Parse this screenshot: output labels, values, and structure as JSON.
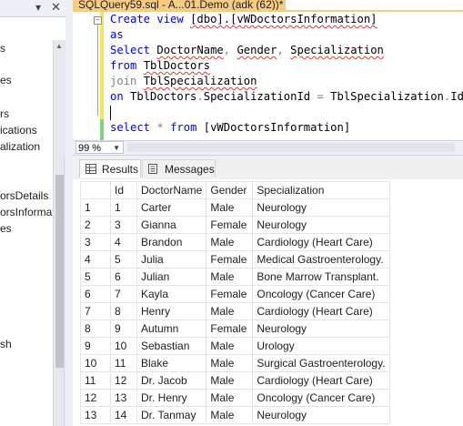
{
  "object_explorer": {
    "items": [
      "s",
      "es",
      "rs",
      "ications",
      "alization",
      "orsDetails",
      "orsInformat",
      "es",
      "sh"
    ]
  },
  "editor": {
    "tab_title": "SQLQuery59.sql - A...01.Demo (adk (62))*",
    "lines": [
      {
        "parts": [
          {
            "t": "Create view ",
            "c": "kw"
          },
          {
            "t": "[dbo].[vWDoctorsInformation]",
            "c": "sq"
          }
        ]
      },
      {
        "parts": [
          {
            "t": "as",
            "c": "kw"
          }
        ]
      },
      {
        "parts": [
          {
            "t": "Select ",
            "c": "kw"
          },
          {
            "t": "DoctorName",
            "c": "sq"
          },
          {
            "t": ", ",
            "c": "gr"
          },
          {
            "t": "Gender",
            "c": "sq"
          },
          {
            "t": ", ",
            "c": "gr"
          },
          {
            "t": "Specialization",
            "c": "sq"
          }
        ]
      },
      {
        "parts": [
          {
            "t": "from ",
            "c": "kw"
          },
          {
            "t": "TblDoctors",
            "c": "sq"
          }
        ]
      },
      {
        "parts": [
          {
            "t": "join ",
            "c": "gr"
          },
          {
            "t": "TblSpecialization",
            "c": "sq"
          }
        ]
      },
      {
        "parts": [
          {
            "t": "on ",
            "c": "kw"
          },
          {
            "t": "TblDoctors",
            "c": "plain"
          },
          {
            "t": ".",
            "c": "gr"
          },
          {
            "t": "SpecializationId",
            "c": "plain"
          },
          {
            "t": " = ",
            "c": "gr"
          },
          {
            "t": "TblSpecialization",
            "c": "plain"
          },
          {
            "t": ".",
            "c": "gr"
          },
          {
            "t": "Id",
            "c": "plain"
          }
        ]
      },
      {
        "parts": []
      },
      {
        "parts": [
          {
            "t": "select ",
            "c": "kw"
          },
          {
            "t": "* ",
            "c": "gr"
          },
          {
            "t": "from ",
            "c": "kw"
          },
          {
            "t": "[vWDoctorsInformation]",
            "c": "plain"
          }
        ]
      }
    ]
  },
  "zoom": {
    "value": "99 %"
  },
  "results": {
    "tabs": [
      "Results",
      "Messages"
    ],
    "columns": [
      "Id",
      "DoctorName",
      "Gender",
      "Specialization"
    ],
    "rows": [
      [
        "1",
        "1",
        "Carter",
        "Male",
        "Neurology"
      ],
      [
        "2",
        "3",
        "Gianna",
        "Female",
        "Neurology"
      ],
      [
        "3",
        "4",
        "Brandon",
        "Male",
        "Cardiology (Heart Care)"
      ],
      [
        "4",
        "5",
        "Julia",
        "Female",
        "Medical Gastroenterology."
      ],
      [
        "5",
        "6",
        "Julian",
        "Male",
        "Bone Marrow Transplant."
      ],
      [
        "6",
        "7",
        "Kayla",
        "Female",
        "Oncology (Cancer Care)"
      ],
      [
        "7",
        "8",
        "Henry",
        "Male",
        "Cardiology (Heart Care)"
      ],
      [
        "8",
        "9",
        "Autumn",
        "Female",
        "Neurology"
      ],
      [
        "9",
        "10",
        "Sebastian",
        "Male",
        "Urology"
      ],
      [
        "10",
        "11",
        "Blake",
        "Male",
        "Surgical Gastroenterology."
      ],
      [
        "11",
        "12",
        "Dr. Jacob",
        "Male",
        "Cardiology (Heart Care)"
      ],
      [
        "12",
        "13",
        "Dr. Henry",
        "Male",
        "Oncology (Cancer Care)"
      ],
      [
        "13",
        "14",
        "Dr. Tanmay",
        "Male",
        "Neurology"
      ]
    ]
  },
  "colors": {
    "tab_active": "#f5cc84",
    "keyword": "#0000ff",
    "gray": "#808080",
    "modified_bar": "#f3e65a",
    "saved_bar": "#7fd27f"
  }
}
